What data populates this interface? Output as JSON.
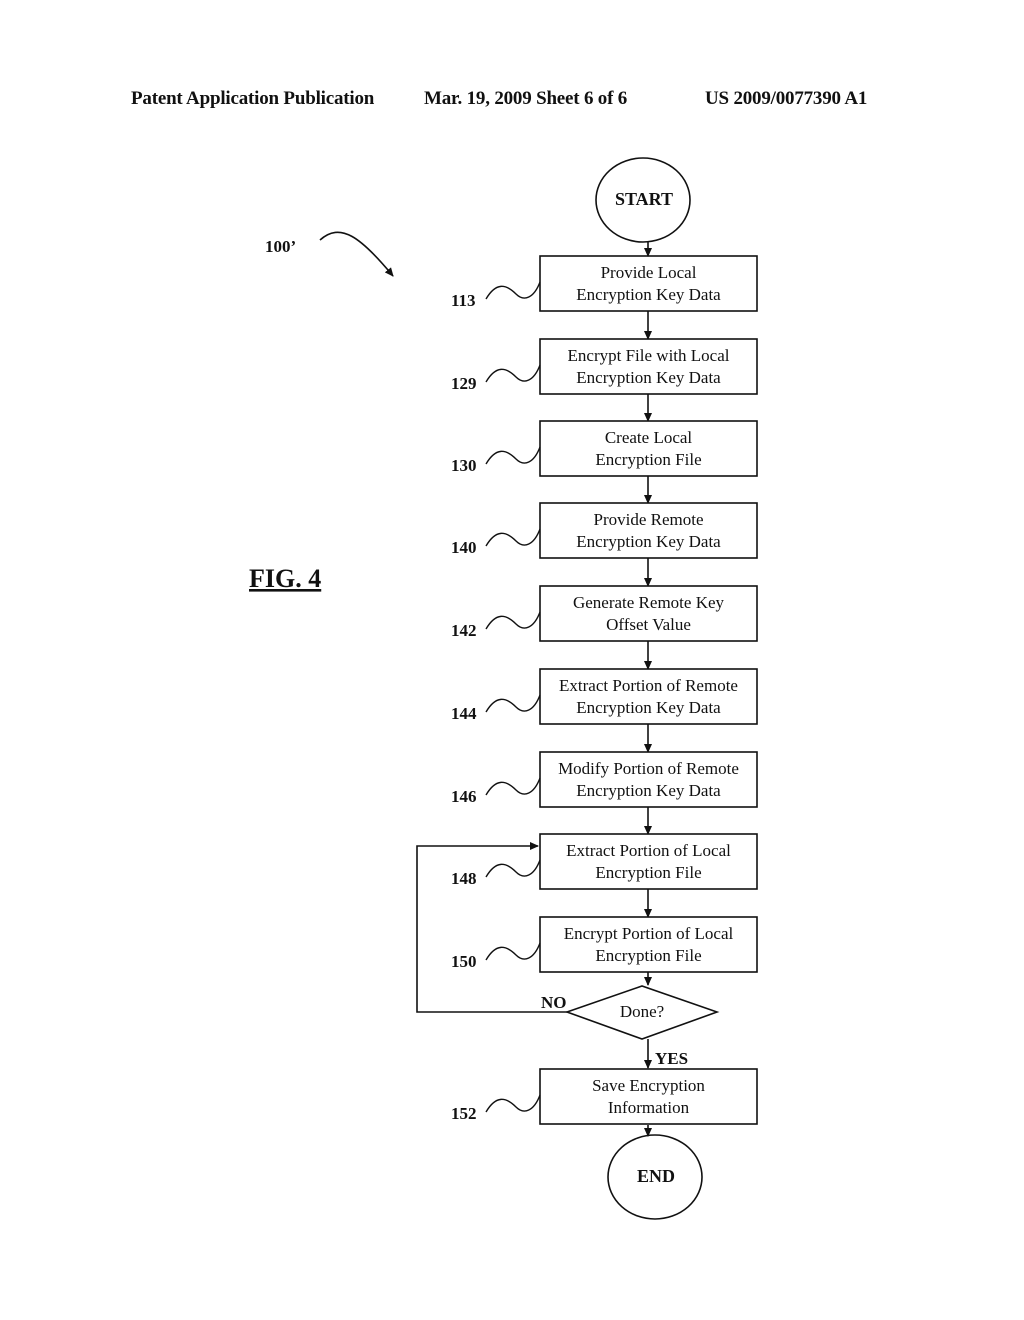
{
  "header": {
    "left": "Patent Application Publication",
    "middle": "Mar. 19, 2009  Sheet 6 of 6",
    "right": "US 2009/0077390 A1"
  },
  "figure": {
    "label": "FIG. 4",
    "reference": "100’"
  },
  "flow": {
    "start": "START",
    "end": "END",
    "steps": [
      {
        "ref": "113",
        "lines": [
          "Provide Local",
          "Encryption Key Data"
        ]
      },
      {
        "ref": "129",
        "lines": [
          "Encrypt File with Local",
          "Encryption Key Data"
        ]
      },
      {
        "ref": "130",
        "lines": [
          "Create Local",
          "Encryption File"
        ]
      },
      {
        "ref": "140",
        "lines": [
          "Provide Remote",
          "Encryption Key Data"
        ]
      },
      {
        "ref": "142",
        "lines": [
          "Generate Remote Key",
          "Offset Value"
        ]
      },
      {
        "ref": "144",
        "lines": [
          "Extract Portion of Remote",
          "Encryption Key Data"
        ]
      },
      {
        "ref": "146",
        "lines": [
          "Modify Portion of Remote",
          "Encryption Key Data"
        ]
      },
      {
        "ref": "148",
        "lines": [
          "Extract Portion of Local",
          "Encryption File"
        ]
      },
      {
        "ref": "150",
        "lines": [
          "Encrypt Portion of Local",
          "Encryption File"
        ]
      }
    ],
    "decision": {
      "label": "Done?",
      "no": "NO",
      "yes": "YES"
    },
    "final_step": {
      "ref": "152",
      "lines": [
        "Save Encryption",
        "Information"
      ]
    }
  }
}
